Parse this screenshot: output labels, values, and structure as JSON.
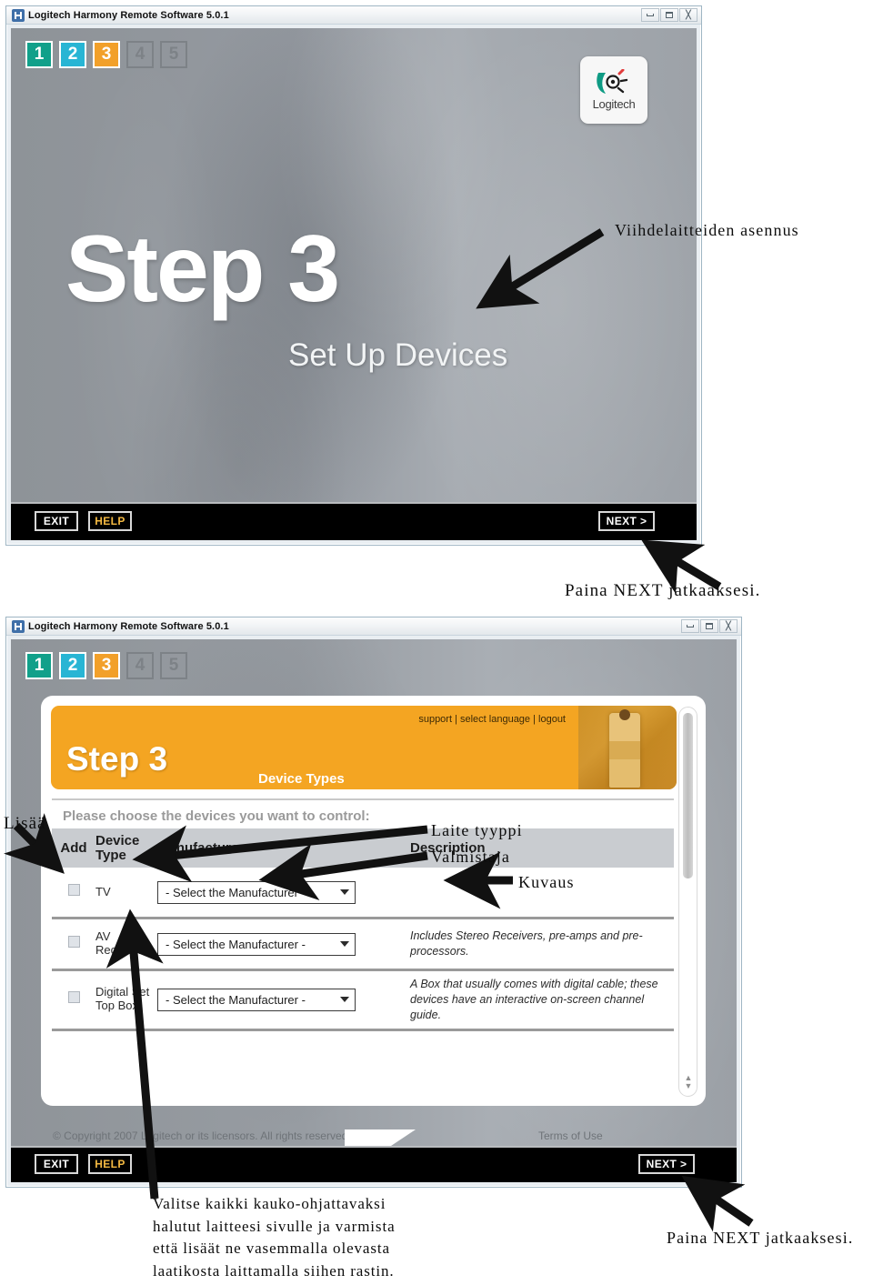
{
  "window1": {
    "title": "Logitech Harmony Remote Software 5.0.1",
    "icon": "harmony-app-icon",
    "controls": {
      "minimize": "minimize-icon",
      "maximize": "maximize-icon",
      "close": "close-icon"
    },
    "steps": [
      {
        "label": "1",
        "state": "done",
        "color": "#11a08a"
      },
      {
        "label": "2",
        "state": "done",
        "color": "#28b5d4"
      },
      {
        "label": "3",
        "state": "current",
        "color": "#f2a02a"
      },
      {
        "label": "4",
        "state": "pending",
        "color": "#7d8287"
      },
      {
        "label": "5",
        "state": "pending",
        "color": "#7d8287"
      }
    ],
    "logo": {
      "text": "Logitech"
    },
    "heading": "Step 3",
    "subheading": "Set Up Devices",
    "footer": {
      "exit": "EXIT",
      "help": "HELP",
      "next": "NEXT >"
    }
  },
  "window2": {
    "title": "Logitech Harmony Remote Software 5.0.1",
    "controls": {
      "minimize": "minimize-icon",
      "maximize": "maximize-icon",
      "close": "close-icon"
    },
    "steps": [
      {
        "label": "1",
        "state": "done",
        "color": "#11a08a"
      },
      {
        "label": "2",
        "state": "done",
        "color": "#28b5d4"
      },
      {
        "label": "3",
        "state": "current",
        "color": "#f2a02a"
      },
      {
        "label": "4",
        "state": "pending",
        "color": "#7d8287"
      },
      {
        "label": "5",
        "state": "pending",
        "color": "#7d8287"
      }
    ],
    "banner": {
      "links": "support | select language | logout",
      "step": "Step 3",
      "section": "Device Types"
    },
    "instruction": "Please choose the devices you want to control:",
    "table": {
      "headers": {
        "add": "Add",
        "device_type": "Device Type",
        "manufacturer": "Manufacturer",
        "description": "Description"
      },
      "rows": [
        {
          "checked": false,
          "device_type": "TV",
          "manufacturer": "- Select the Manufacturer -",
          "description": ""
        },
        {
          "checked": false,
          "device_type": "AV Receiver",
          "manufacturer": "- Select the Manufacturer -",
          "description": "Includes Stereo Receivers, pre-amps and pre-processors."
        },
        {
          "checked": false,
          "device_type": "Digital Set Top Box",
          "manufacturer": "- Select the Manufacturer -",
          "description": "A Box that usually comes with digital cable; these devices have an interactive on-screen channel guide."
        }
      ]
    },
    "copyright": "© Copyright 2007 Logitech or its licensors. All rights reserved.",
    "terms": "Terms of Use",
    "footer": {
      "exit": "EXIT",
      "help": "HELP",
      "next": "NEXT >"
    }
  },
  "annotations": {
    "a1": "Viihdelaitteiden asennus",
    "a2": "Paina NEXT jatkaaksesi.",
    "a3": "Lisää",
    "a4": "Laite tyyppi",
    "a5": "Valmistaja",
    "a6": "Kuvaus",
    "a7": "Valitse kaikki kauko-ohjattavaksi\nhalutut laitteesi sivulle ja varmista\nettä lisäät ne vasemmalla olevasta\nlaatikosta laittamalla siihen rastin.",
    "a8": "Paina NEXT jatkaaksesi."
  }
}
